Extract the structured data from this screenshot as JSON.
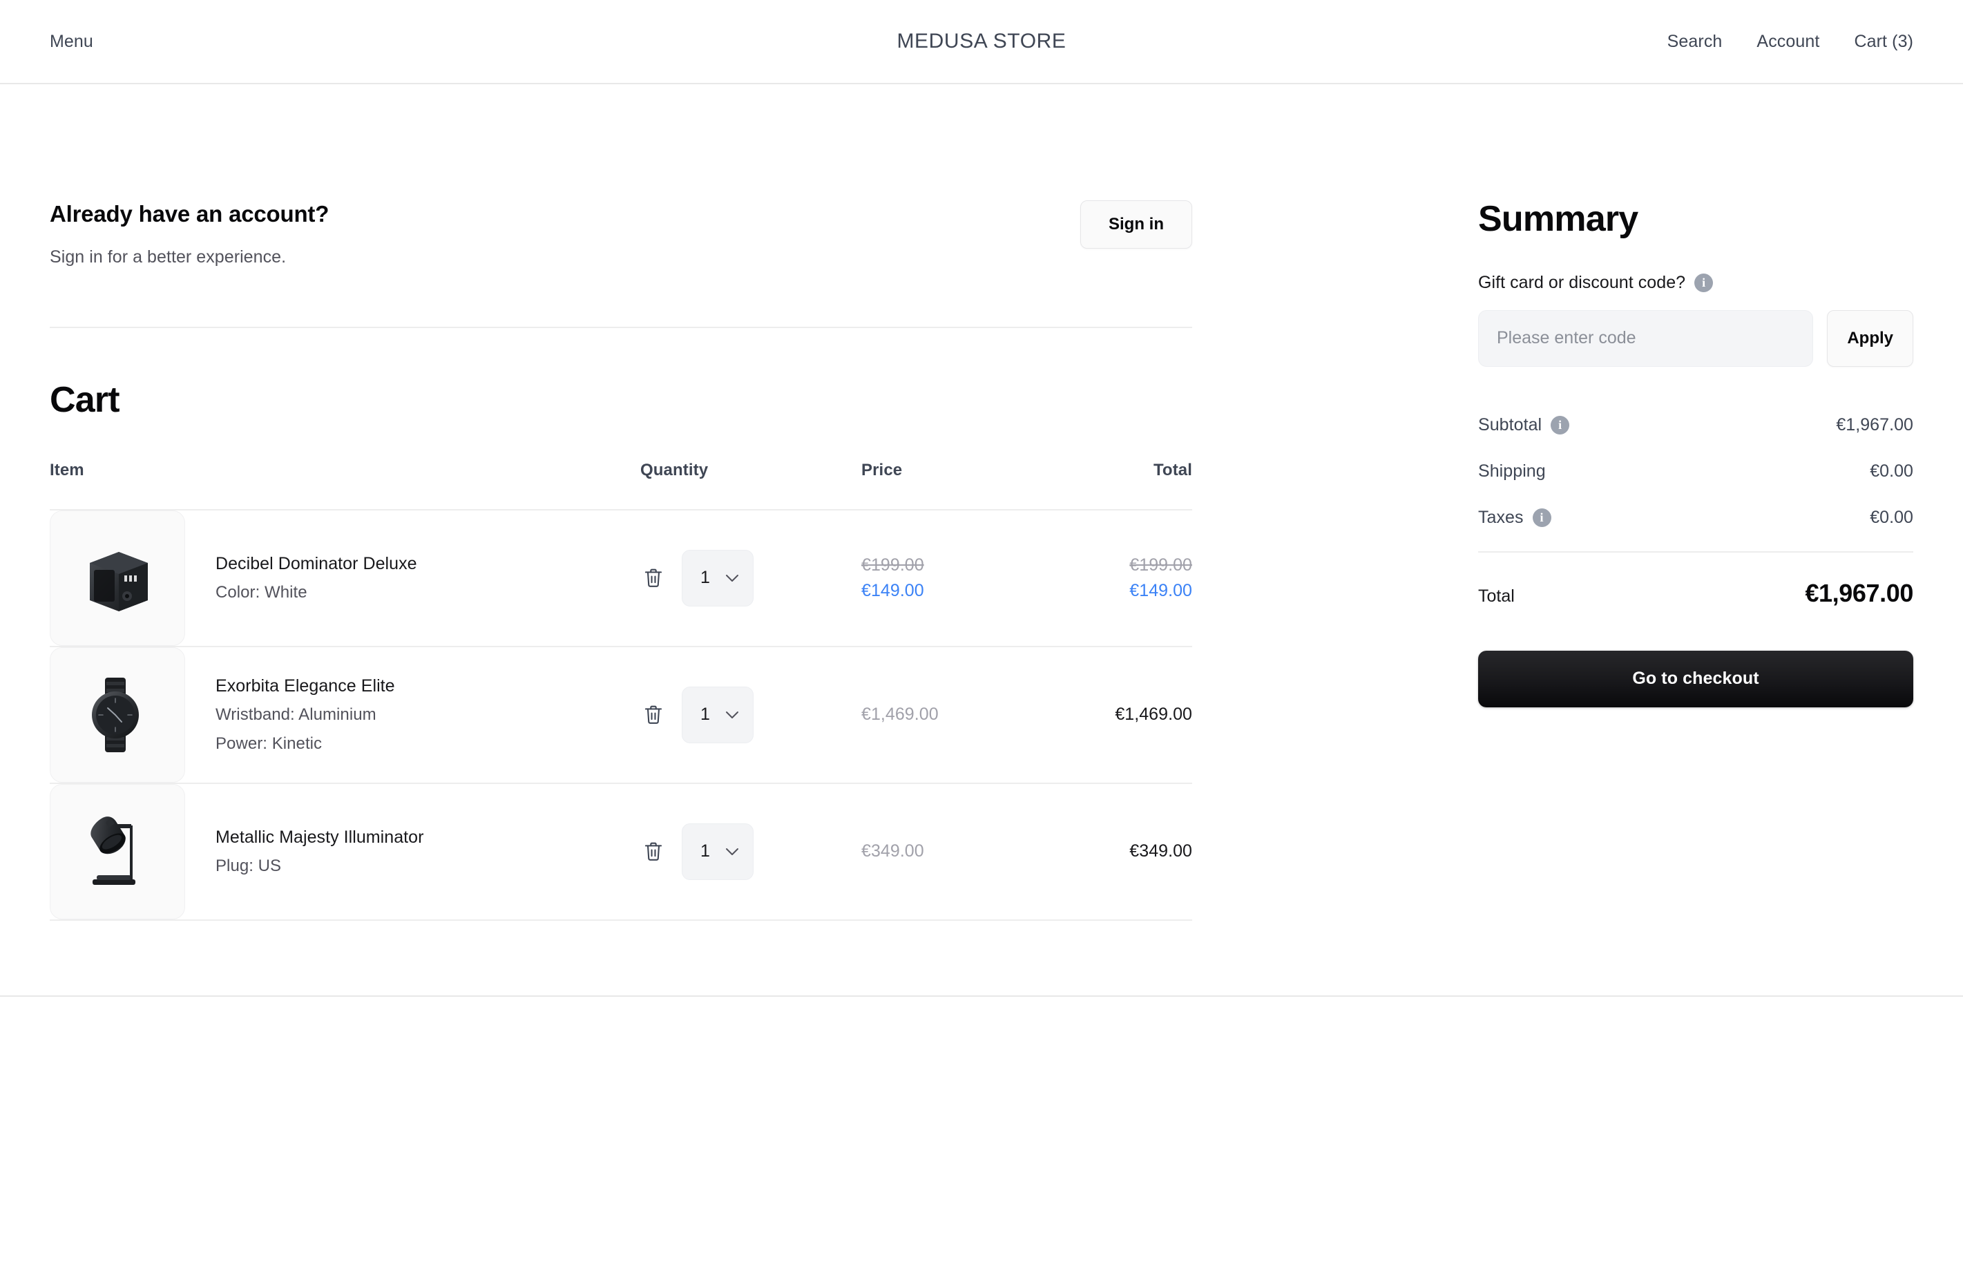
{
  "header": {
    "menu_label": "Menu",
    "brand": "MEDUSA STORE",
    "search_label": "Search",
    "account_label": "Account",
    "cart_label": "Cart (3)"
  },
  "signin": {
    "heading": "Already have an account?",
    "subtext": "Sign in for a better experience.",
    "button_label": "Sign in"
  },
  "cart": {
    "title": "Cart",
    "columns": {
      "item": "Item",
      "quantity": "Quantity",
      "price": "Price",
      "total": "Total"
    },
    "items": [
      {
        "name": "Decibel Dominator Deluxe",
        "option1": "Color: White",
        "option2": "",
        "quantity": "1",
        "price_original": "€199.00",
        "price_discounted": "€149.00",
        "total_original": "€199.00",
        "total_discounted": "€149.00",
        "discounted": true,
        "thumb": "speaker-image"
      },
      {
        "name": "Exorbita Elegance Elite",
        "option1": "Wristband: Aluminium",
        "option2": "Power: Kinetic",
        "quantity": "1",
        "price_original": "€1,469.00",
        "price_discounted": "",
        "total_original": "",
        "total_discounted": "€1,469.00",
        "discounted": false,
        "thumb": "watch-image"
      },
      {
        "name": "Metallic Majesty Illuminator",
        "option1": "Plug: US",
        "option2": "",
        "quantity": "1",
        "price_original": "€349.00",
        "price_discounted": "",
        "total_original": "",
        "total_discounted": "€349.00",
        "discounted": false,
        "thumb": "lamp-image"
      }
    ]
  },
  "summary": {
    "title": "Summary",
    "discount_label": "Gift card or discount code?",
    "code_placeholder": "Please enter code",
    "code_value": "",
    "apply_label": "Apply",
    "subtotal_label": "Subtotal",
    "subtotal_value": "€1,967.00",
    "shipping_label": "Shipping",
    "shipping_value": "€0.00",
    "taxes_label": "Taxes",
    "taxes_value": "€0.00",
    "total_label": "Total",
    "total_value": "€1,967.00",
    "checkout_label": "Go to checkout"
  },
  "colors": {
    "discount_blue": "#3b82f6",
    "muted": "#a1a1aa",
    "text": "#18181b",
    "checkout_bg": "#09090b"
  }
}
